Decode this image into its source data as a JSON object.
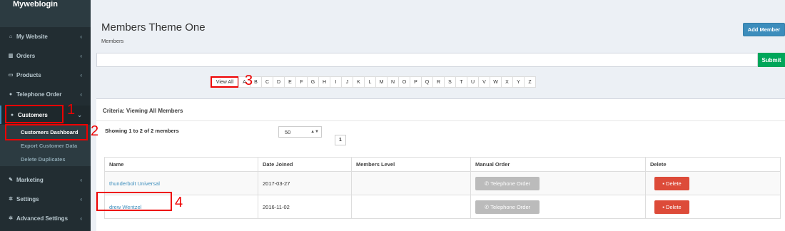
{
  "brand": "Myweblogin",
  "sidebar": {
    "items": [
      {
        "label": "My Website",
        "icon": "home-icon"
      },
      {
        "label": "Orders",
        "icon": "bar-chart-icon"
      },
      {
        "label": "Products",
        "icon": "monitor-icon"
      },
      {
        "label": "Telephone Order",
        "icon": "users-icon"
      },
      {
        "label": "Customers",
        "icon": "users-icon"
      },
      {
        "label": "Marketing",
        "icon": "wrench-icon"
      },
      {
        "label": "Settings",
        "icon": "gear-icon"
      },
      {
        "label": "Advanced Settings",
        "icon": "gears-icon"
      }
    ],
    "customers_sub": [
      "Customers Dashboard",
      "Export Customer Data",
      "Delete Duplicates"
    ]
  },
  "header": {
    "title": "Members Theme One",
    "breadcrumb": "Members",
    "add_member_label": "Add Member"
  },
  "search": {
    "value": "",
    "submit_label": "Submit"
  },
  "alpha_filter": [
    "View All",
    "A",
    "B",
    "C",
    "D",
    "E",
    "F",
    "G",
    "H",
    "I",
    "J",
    "K",
    "L",
    "M",
    "N",
    "O",
    "P",
    "Q",
    "R",
    "S",
    "T",
    "U",
    "V",
    "W",
    "X",
    "Y",
    "Z"
  ],
  "box": {
    "criteria": "Criteria: Viewing All Members",
    "showing": "Showing 1 to 2 of 2 members",
    "per_page": "50",
    "page": "1"
  },
  "table": {
    "headers": [
      "Name",
      "Date Joined",
      "Members Level",
      "Manual Order",
      "Delete"
    ],
    "rows": [
      {
        "name": "thunderbolt Universal",
        "date": "2017-03-27",
        "level": "",
        "order_label": "Telephone Order",
        "delete_label": "Delete"
      },
      {
        "name": "drew Wentzel",
        "date": "2016-11-02",
        "level": "",
        "order_label": "Telephone Order",
        "delete_label": "Delete"
      }
    ]
  },
  "annotations": [
    "1",
    "2",
    "3",
    "4"
  ],
  "colors": {
    "sidebar": "#222d32",
    "primary": "#3c8dbc",
    "success": "#00a65a",
    "danger": "#dd4b39",
    "annotation": "#e00000"
  }
}
